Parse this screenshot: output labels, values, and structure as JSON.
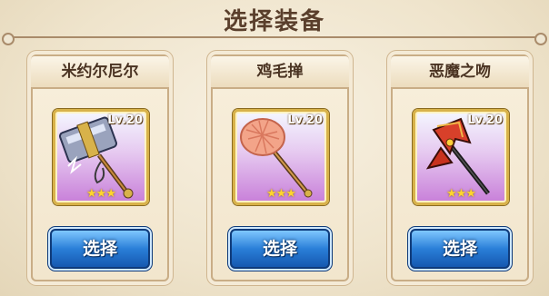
{
  "title": "选择装备",
  "cards": [
    {
      "name": "米约尔尼尔",
      "level": "Lv.20",
      "stars": "★★★",
      "button": "选择"
    },
    {
      "name": "鸡毛掸",
      "level": "Lv.20",
      "stars": "★★★",
      "button": "选择"
    },
    {
      "name": "恶魔之吻",
      "level": "Lv.20",
      "stars": "★★★",
      "button": "选择"
    }
  ],
  "colors": {
    "title": "#5a3f2c",
    "button": "#2a7fd8",
    "frame": "#d8b24a",
    "star": "#ffd52e"
  },
  "icons": [
    "hammer-icon",
    "feather-duster-icon",
    "demon-axe-icon"
  ]
}
